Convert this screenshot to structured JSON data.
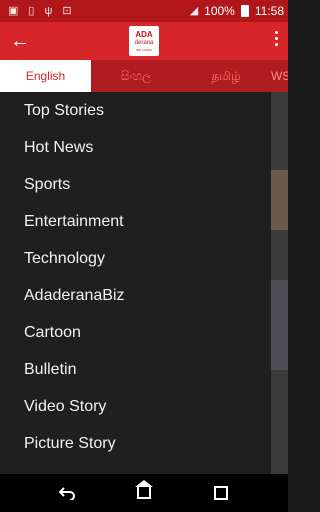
{
  "status_bar": {
    "battery": "100%",
    "time": "11:58",
    "icons": [
      "gallery-icon",
      "vibrate-icon",
      "usb-icon",
      "cast-icon",
      "signal-icon",
      "battery-icon"
    ]
  },
  "app_bar": {
    "back_icon": "arrow-left-icon",
    "logo": {
      "line1": "ADA",
      "line2": "derana",
      "tagline": "SRI LANKA"
    },
    "menu_icon": "vertical-dots-icon",
    "accent": "#d7262a"
  },
  "tabs": [
    {
      "label": "English",
      "active": true
    },
    {
      "label": "සිංහල",
      "active": false
    },
    {
      "label": "தமிழ்",
      "active": false
    },
    {
      "label": "WS",
      "active": false
    }
  ],
  "drawer": {
    "items": [
      "Top Stories",
      "Hot News",
      "Sports",
      "Entertainment",
      "Technology",
      "AdaderanaBiz",
      "Cartoon",
      "Bulletin",
      "Video Story",
      "Picture Story"
    ]
  },
  "system_nav": [
    "back-icon",
    "home-icon",
    "recents-icon"
  ]
}
